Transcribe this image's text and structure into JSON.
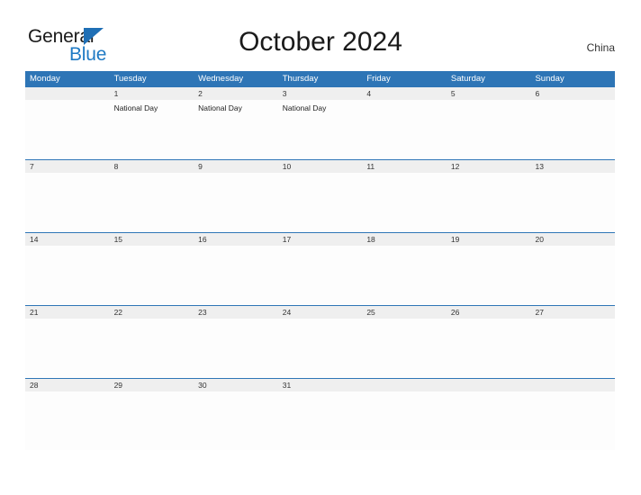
{
  "brand": {
    "name_part1": "General",
    "name_part2": "Blue",
    "flag_icon": "blue-triangle-flag-icon"
  },
  "header": {
    "title": "October 2024",
    "country": "China"
  },
  "colors": {
    "header_blue": "#2e75b6",
    "date_strip_gray": "#efefef",
    "brand_blue": "#1f7ac4",
    "text_dark": "#1a1a1a"
  },
  "calendar": {
    "weekdays": [
      "Monday",
      "Tuesday",
      "Wednesday",
      "Thursday",
      "Friday",
      "Saturday",
      "Sunday"
    ],
    "weeks": [
      {
        "days": [
          {
            "date": "",
            "events": []
          },
          {
            "date": "1",
            "events": [
              "National Day"
            ]
          },
          {
            "date": "2",
            "events": [
              "National Day"
            ]
          },
          {
            "date": "3",
            "events": [
              "National Day"
            ]
          },
          {
            "date": "4",
            "events": []
          },
          {
            "date": "5",
            "events": []
          },
          {
            "date": "6",
            "events": []
          }
        ]
      },
      {
        "days": [
          {
            "date": "7",
            "events": []
          },
          {
            "date": "8",
            "events": []
          },
          {
            "date": "9",
            "events": []
          },
          {
            "date": "10",
            "events": []
          },
          {
            "date": "11",
            "events": []
          },
          {
            "date": "12",
            "events": []
          },
          {
            "date": "13",
            "events": []
          }
        ]
      },
      {
        "days": [
          {
            "date": "14",
            "events": []
          },
          {
            "date": "15",
            "events": []
          },
          {
            "date": "16",
            "events": []
          },
          {
            "date": "17",
            "events": []
          },
          {
            "date": "18",
            "events": []
          },
          {
            "date": "19",
            "events": []
          },
          {
            "date": "20",
            "events": []
          }
        ]
      },
      {
        "days": [
          {
            "date": "21",
            "events": []
          },
          {
            "date": "22",
            "events": []
          },
          {
            "date": "23",
            "events": []
          },
          {
            "date": "24",
            "events": []
          },
          {
            "date": "25",
            "events": []
          },
          {
            "date": "26",
            "events": []
          },
          {
            "date": "27",
            "events": []
          }
        ]
      },
      {
        "days": [
          {
            "date": "28",
            "events": []
          },
          {
            "date": "29",
            "events": []
          },
          {
            "date": "30",
            "events": []
          },
          {
            "date": "31",
            "events": []
          },
          {
            "date": "",
            "events": []
          },
          {
            "date": "",
            "events": []
          },
          {
            "date": "",
            "events": []
          }
        ]
      }
    ]
  }
}
